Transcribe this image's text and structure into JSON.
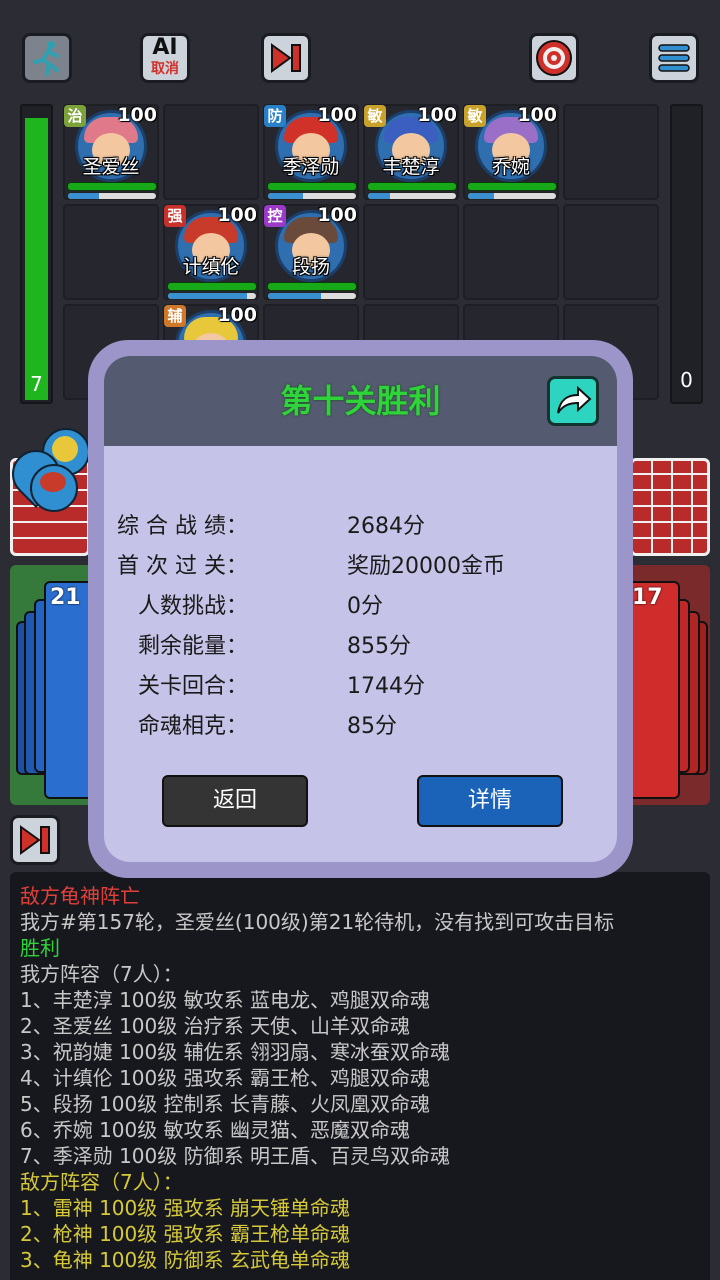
{
  "top_bar": {
    "ai_label_top": "AI",
    "ai_label_bottom": "取消"
  },
  "energy": {
    "left_value": "7",
    "right_value": "0"
  },
  "heroes": [
    {
      "name": "圣爱丝",
      "role": "治",
      "level": "100",
      "role_color": "#7ea23a",
      "hair": "#e07a8a"
    },
    {
      "name": "季泽勋",
      "role": "防",
      "level": "100",
      "role_color": "#2a80c8",
      "hair": "#d0322a"
    },
    {
      "name": "丰楚淳",
      "role": "敏",
      "level": "100",
      "role_color": "#c9a22c",
      "hair": "#3a5fc0"
    },
    {
      "name": "乔婉",
      "role": "敏",
      "level": "100",
      "role_color": "#c9a22c",
      "hair": "#9a6fc8"
    },
    {
      "name": "计缜伦",
      "role": "强",
      "level": "100",
      "role_color": "#c8302a",
      "hair": "#c83a2a"
    },
    {
      "name": "段扬",
      "role": "控",
      "level": "100",
      "role_color": "#9b3ac8",
      "hair": "#6a4a3a"
    },
    {
      "name": "",
      "role": "辅",
      "level": "100",
      "role_color": "#d0782a",
      "hair": "#e8c83a"
    }
  ],
  "deck": {
    "left_count": "21",
    "right_count": "17"
  },
  "modal": {
    "title": "第十关胜利",
    "stats": [
      {
        "label": "综 合 战 绩：",
        "value": "2684分"
      },
      {
        "label": "首 次 过 关：",
        "value": "奖励20000金币"
      },
      {
        "label": "人数挑战：",
        "value": "0分"
      },
      {
        "label": "剩余能量：",
        "value": "855分"
      },
      {
        "label": "关卡回合：",
        "value": "1744分"
      },
      {
        "label": "命魂相克：",
        "value": "85分"
      }
    ],
    "back_label": "返回",
    "detail_label": "详情"
  },
  "log": [
    {
      "text": "敌方龟神阵亡",
      "color": "red"
    },
    {
      "text": "我方#第157轮，圣爱丝(100级)第21轮待机，没有找到可攻击目标",
      "color": "grey"
    },
    {
      "text": "胜利",
      "color": "green"
    },
    {
      "text": "我方阵容（7人）：",
      "color": "grey"
    },
    {
      "text": "1、丰楚淳 100级 敏攻系 蓝电龙、鸡腿双命魂",
      "color": "grey"
    },
    {
      "text": "2、圣爱丝 100级 治疗系 天使、山羊双命魂",
      "color": "grey"
    },
    {
      "text": "3、祝韵婕 100级 辅佐系 翎羽扇、寒冰蚕双命魂",
      "color": "grey"
    },
    {
      "text": "4、计缜伦 100级 强攻系 霸王枪、鸡腿双命魂",
      "color": "grey"
    },
    {
      "text": "5、段扬 100级 控制系 长青藤、火凤凰双命魂",
      "color": "grey"
    },
    {
      "text": "6、乔婉 100级 敏攻系 幽灵猫、恶魔双命魂",
      "color": "grey"
    },
    {
      "text": "7、季泽勋 100级 防御系 明王盾、百灵鸟双命魂",
      "color": "grey"
    },
    {
      "text": "敌方阵容（7人）：",
      "color": "yellow"
    },
    {
      "text": "1、雷神 100级 强攻系 崩天锤单命魂",
      "color": "yellow"
    },
    {
      "text": "2、枪神 100级 强攻系 霸王枪单命魂",
      "color": "yellow"
    },
    {
      "text": "3、龟神 100级 防御系 玄武龟单命魂",
      "color": "yellow"
    }
  ]
}
